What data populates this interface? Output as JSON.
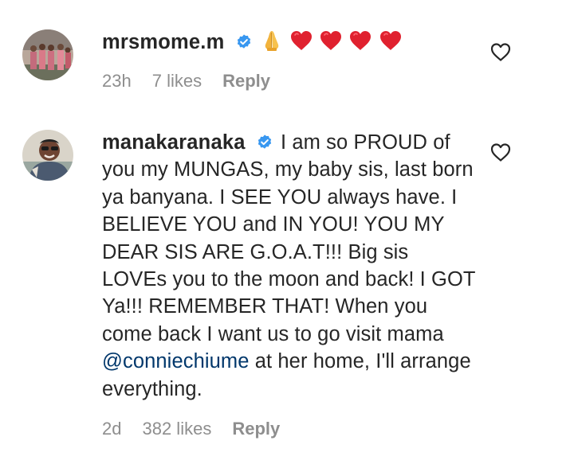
{
  "comments": [
    {
      "username": "mrsmome.m",
      "verified": true,
      "emojis": [
        "folded-hands",
        "red-heart",
        "red-heart",
        "red-heart",
        "red-heart"
      ],
      "time": "23h",
      "likes": "7 likes",
      "reply": "Reply"
    },
    {
      "username": "manakaranaka",
      "verified": true,
      "text_before_mention": "I am so PROUD of you my MUNGAS, my baby sis, last born ya banyana. I SEE YOU always have. I BELIEVE YOU and IN YOU! YOU MY DEAR SIS ARE G.O.A.T!!! Big sis LOVEs you to the moon and back! I GOT Ya!!! REMEMBER THAT! When you come back I want us to go visit mama",
      "mention": "@conniechiume",
      "text_after_mention": "at her home, I'll arrange everything.",
      "time": "2d",
      "likes": "382 likes",
      "reply": "Reply"
    }
  ],
  "colors": {
    "text": "#262626",
    "secondary": "#8e8e8e",
    "mention": "#00376b",
    "verified": "#3897f0",
    "heart_emoji": "#e0212f"
  },
  "icons": {
    "verified": "verified-badge-icon",
    "like": "heart-outline-icon"
  }
}
